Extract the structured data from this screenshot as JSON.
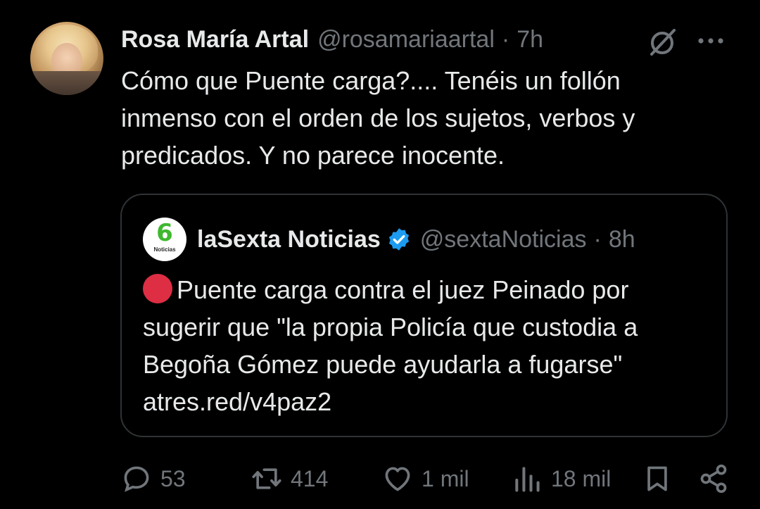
{
  "tweet": {
    "author": {
      "display_name": "Rosa María Artal",
      "handle": "@rosamariaartal",
      "separator": "·",
      "time": "7h"
    },
    "text": "Cómo que Puente carga?.... Tenéis un follón\ninmenso con el orden de los sujetos, verbos y\npredicados. Y no parece inocente.",
    "icons": {
      "grok": "grok-icon",
      "more": "more-icon"
    }
  },
  "quote": {
    "avatar_text": {
      "number": "6",
      "label": "Noticias"
    },
    "author": {
      "display_name": "laSexta Noticias",
      "handle": "@sextaNoticias",
      "separator": "·",
      "time": "8h"
    },
    "text": "Puente carga contra el juez Peinado por sugerir que \"la propia Policía que custodia a Begoña Gómez puede ayudarla a fugarse\" atres.red/v4paz2",
    "verified_color": "#1d9bf0",
    "bullet_color": "#dd2e44"
  },
  "actions": {
    "replies": "53",
    "reposts": "414",
    "likes": "1 mil",
    "views": "18 mil"
  },
  "colors": {
    "background": "#000000",
    "text": "#e7e9ea",
    "muted": "#71767b",
    "border": "#2f3336"
  }
}
